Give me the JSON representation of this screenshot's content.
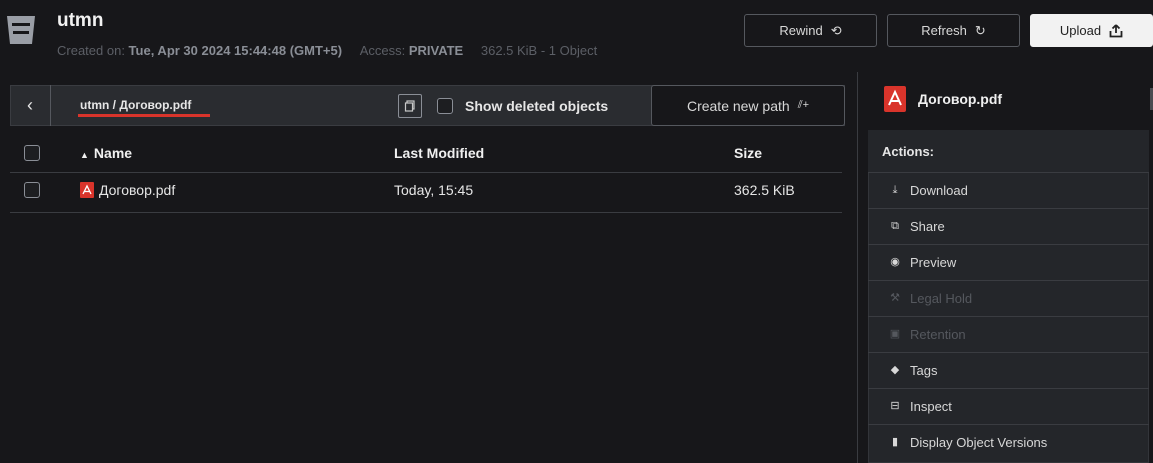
{
  "header": {
    "bucket_name": "utmn",
    "created_label": "Created on: ",
    "created_value": "Tue, Apr 30 2024 15:44:48 (GMT+5)",
    "access_label": "Access: ",
    "access_value": "PRIVATE",
    "usage": "362.5 KiB - 1 Object",
    "buttons": {
      "rewind": "Rewind",
      "refresh": "Refresh",
      "upload": "Upload"
    }
  },
  "pathbar": {
    "path": "utmn / Договор.pdf",
    "show_deleted_label": "Show deleted objects",
    "create_path_label": "Create new path"
  },
  "table": {
    "columns": {
      "name": "Name",
      "last_modified": "Last Modified",
      "size": "Size"
    },
    "rows": [
      {
        "name": "Договор.pdf",
        "last_modified": "Today, 15:45",
        "size": "362.5 KiB"
      }
    ]
  },
  "details": {
    "object_name": "Договор.pdf",
    "actions_title": "Actions:",
    "actions": [
      {
        "label": "Download",
        "icon": "download-icon",
        "enabled": true
      },
      {
        "label": "Share",
        "icon": "share-icon",
        "enabled": true
      },
      {
        "label": "Preview",
        "icon": "eye-icon",
        "enabled": true
      },
      {
        "label": "Legal Hold",
        "icon": "gavel-icon",
        "enabled": false
      },
      {
        "label": "Retention",
        "icon": "retention-icon",
        "enabled": false
      },
      {
        "label": "Tags",
        "icon": "tag-icon",
        "enabled": true
      },
      {
        "label": "Inspect",
        "icon": "inspect-icon",
        "enabled": true
      },
      {
        "label": "Display Object Versions",
        "icon": "versions-icon",
        "enabled": true
      }
    ]
  },
  "colors": {
    "background": "#17171a",
    "accent_red": "#d9342b",
    "panel": "#24262a"
  }
}
